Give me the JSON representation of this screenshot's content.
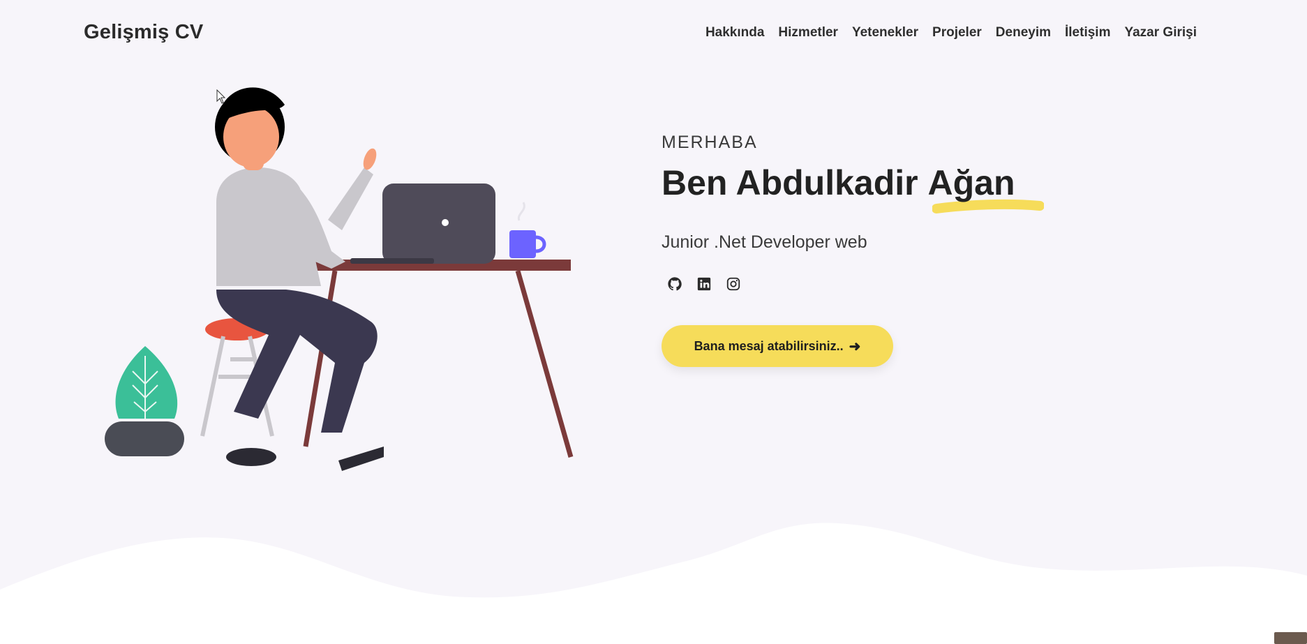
{
  "header": {
    "brand": "Gelişmiş CV",
    "nav": [
      {
        "label": "Hakkında"
      },
      {
        "label": "Hizmetler"
      },
      {
        "label": "Yetenekler"
      },
      {
        "label": "Projeler"
      },
      {
        "label": "Deneyim"
      },
      {
        "label": "İletişim"
      },
      {
        "label": "Yazar Girişi"
      }
    ]
  },
  "hero": {
    "greeting": "MERHABA",
    "name_first": "Ben Abdulkadir ",
    "name_last": "Ağan",
    "role": "Junior .Net Developer web",
    "socials": [
      {
        "icon": "github-icon"
      },
      {
        "icon": "linkedin-icon"
      },
      {
        "icon": "instagram-icon"
      }
    ],
    "cta_label": "Bana mesaj atabilirsiniz..",
    "cta_icon": "arrow-right-icon"
  },
  "colors": {
    "background": "#f7f5fa",
    "accent_yellow": "#f6dc5a",
    "text_dark": "#222222",
    "desk": "#7b3a3a",
    "laptop": "#4f4b59",
    "mug": "#6c63ff",
    "plant": "#3bbf98"
  }
}
